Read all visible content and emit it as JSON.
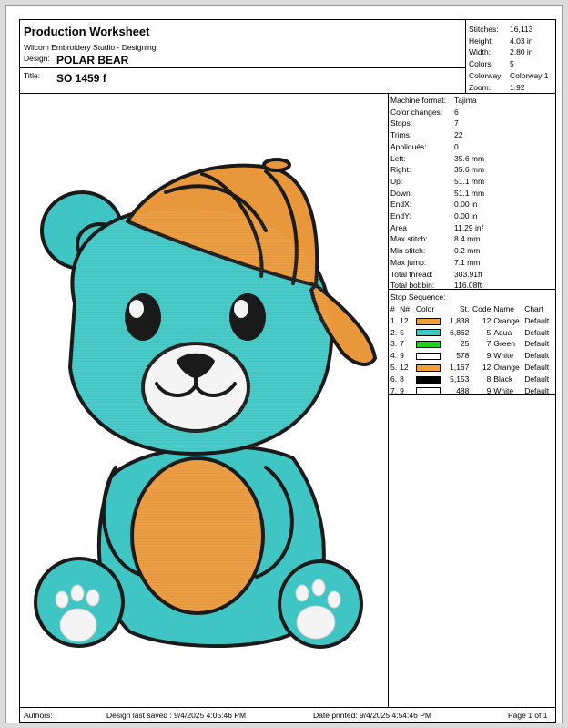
{
  "header": {
    "title": "Production Worksheet",
    "software": "Wilcom  Embroidery Studio - Designing",
    "design_label": "Design:",
    "design_value": "POLAR BEAR",
    "title_label": "Title:",
    "title_value": "SO 1459 f"
  },
  "summary": [
    {
      "label": "Stitches:",
      "value": "16,113"
    },
    {
      "label": "Height:",
      "value": "4.03 in"
    },
    {
      "label": "Width:",
      "value": "2.80 in"
    },
    {
      "label": "Colors:",
      "value": "5"
    },
    {
      "label": "Colorway:",
      "value": "Colorway 1"
    },
    {
      "label": "Zoom:",
      "value": "1.92"
    }
  ],
  "machine": [
    {
      "label": "Machine format:",
      "value": "Tajima"
    },
    {
      "label": "Color changes:",
      "value": "6"
    },
    {
      "label": "Stops:",
      "value": "7"
    },
    {
      "label": "Trims:",
      "value": "22"
    },
    {
      "label": "Appliqués:",
      "value": "0"
    },
    {
      "label": "Left:",
      "value": "35.6 mm"
    },
    {
      "label": "Right:",
      "value": "35.6 mm"
    },
    {
      "label": "Up:",
      "value": "51.1 mm"
    },
    {
      "label": "Down:",
      "value": "51.1 mm"
    },
    {
      "label": "EndX:",
      "value": "0.00 in"
    },
    {
      "label": "EndY:",
      "value": "0.00 in"
    },
    {
      "label": "Area",
      "value": "11.29 in²"
    },
    {
      "label": "Max stitch:",
      "value": "8.4 mm"
    },
    {
      "label": "Min stitch:",
      "value": "0.2 mm"
    },
    {
      "label": "Max jump:",
      "value": "7.1 mm"
    },
    {
      "label": "Total thread:",
      "value": "303.91ft"
    },
    {
      "label": "Total bobbin:",
      "value": "116.08ft"
    }
  ],
  "stop_sequence": {
    "title": "Stop Sequence:",
    "headers": [
      "#",
      "N#",
      "Color",
      "St.",
      "Code",
      "Name",
      "Chart"
    ],
    "rows": [
      {
        "num": "1.",
        "n": "12",
        "color": "#f2a13a",
        "st": "1,838",
        "code": "12",
        "name": "Orange",
        "chart": "Default"
      },
      {
        "num": "2.",
        "n": "5",
        "color": "#3fc6c4",
        "st": "6,862",
        "code": "5",
        "name": "Aqua",
        "chart": "Default"
      },
      {
        "num": "3.",
        "n": "7",
        "color": "#22d11d",
        "st": "25",
        "code": "7",
        "name": "Green",
        "chart": "Default"
      },
      {
        "num": "4.",
        "n": "9",
        "color": "#ffffff",
        "st": "578",
        "code": "9",
        "name": "White",
        "chart": "Default"
      },
      {
        "num": "5.",
        "n": "12",
        "color": "#f2a13a",
        "st": "1,167",
        "code": "12",
        "name": "Orange",
        "chart": "Default"
      },
      {
        "num": "6.",
        "n": "8",
        "color": "#000000",
        "st": "5,153",
        "code": "8",
        "name": "Black",
        "chart": "Default"
      },
      {
        "num": "7.",
        "n": "9",
        "color": "#ffffff",
        "st": "488",
        "code": "9",
        "name": "White",
        "chart": "Default"
      }
    ]
  },
  "footer": {
    "authors": "Authors:",
    "saved": "Design last saved : 9/4/2025 4:05:46 PM",
    "printed": "Date printed: 9/4/2025 4:54:46 PM",
    "page": "Page 1 of 1"
  },
  "colors": {
    "aqua": "#3fc6c4",
    "orange": "#e8973a",
    "outline": "#1a1a1a",
    "white": "#f4f4f4"
  }
}
